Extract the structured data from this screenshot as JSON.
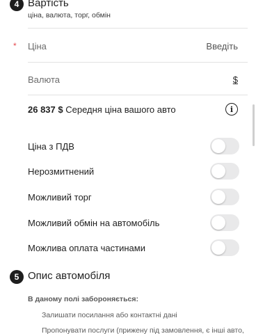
{
  "section4": {
    "number": "4",
    "title": "Вартість",
    "subtitle": "ціна, валюта, торг, обмін"
  },
  "price": {
    "required_mark": "*",
    "label": "Ціна",
    "action": "Введіть"
  },
  "currency": {
    "label": "Валюта",
    "symbol": "$"
  },
  "average": {
    "amount": "26 837 $",
    "text": "Середня ціна вашого авто",
    "info_glyph": "i"
  },
  "options": [
    {
      "label": "Ціна з ПДВ",
      "enabled": false
    },
    {
      "label": "Нерозмитнений",
      "enabled": false
    },
    {
      "label": "Можливий торг",
      "enabled": false
    },
    {
      "label": "Можливий обмін на автомобіль",
      "enabled": false
    },
    {
      "label": "Можлива оплата частинами",
      "enabled": false
    }
  ],
  "section5": {
    "number": "5",
    "title": "Опис автомобіля"
  },
  "rules": {
    "title": "В даному полі забороняється:",
    "items": [
      "Залишати посилання або контактні дані",
      "Пропонувати послуги (прижену під замовлення, є інші авто,"
    ]
  },
  "colors": {
    "accent_required": "#e5484d",
    "toggle_off": "#e9e9ea",
    "badge": "#1e1e1e"
  }
}
